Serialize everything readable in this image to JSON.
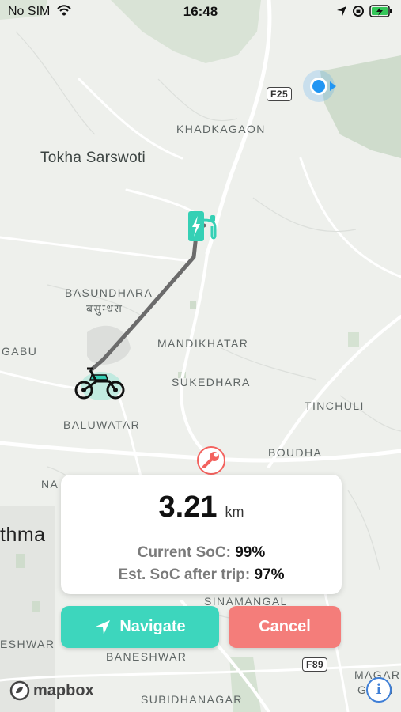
{
  "status_bar": {
    "carrier": "No SIM",
    "time": "16:48"
  },
  "map": {
    "labels": {
      "khadkagaon": "KHADKAGAON",
      "tokha": "Tokha Sarswoti",
      "basundhara": "BASUNDHARA",
      "basundhara_local": "बसुन्धरा",
      "gabu": "GABU",
      "mandikhatar": "MANDIKHATAR",
      "sukedhara": "SUKEDHARA",
      "tinchuli": "TINCHULI",
      "baluwatar": "BALUWATAR",
      "boudha": "BOUDHA",
      "na": "NA",
      "thma": "thma",
      "sinamangal": "SINAMANGAL",
      "eshwar": "ESHWAR",
      "baneshwar": "BANESHWAR",
      "magar": "MAGAR",
      "gaun": "GAUN",
      "subidhanagar": "SUBIDHANAGAR"
    },
    "shields": {
      "f25": "F25",
      "f89": "F89"
    }
  },
  "trip_card": {
    "distance_value": "3.21",
    "distance_unit": "km",
    "current_soc_label": "Current SoC:",
    "current_soc_value": "99%",
    "est_soc_label": "Est. SoC after trip:",
    "est_soc_value": "97%"
  },
  "buttons": {
    "navigate": "Navigate",
    "cancel": "Cancel"
  },
  "attribution": {
    "mapbox": "mapbox"
  },
  "colors": {
    "accent": "#3dd6bd",
    "cancel": "#f47d7a",
    "route": "#6b6b6b",
    "user_location": "#2196f3"
  }
}
